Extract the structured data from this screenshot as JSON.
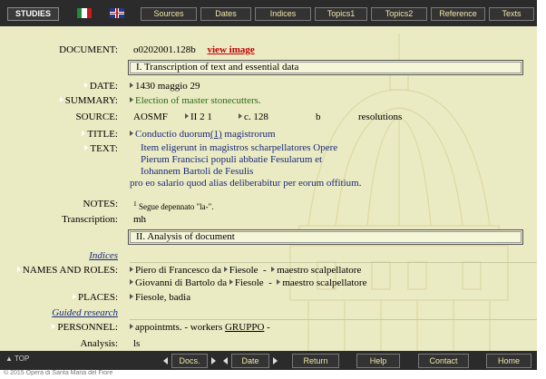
{
  "topbar": {
    "brand": "STUDIES",
    "nav": [
      "Sources",
      "Dates",
      "Indices",
      "Topics1",
      "Topics2",
      "Reference",
      "Texts"
    ]
  },
  "record": {
    "document_label": "DOCUMENT:",
    "document_id": "o0202001.128b",
    "view_image": "view image",
    "section1": "I. Transcription of text and essential data",
    "date_label": "DATE:",
    "date": "1430 maggio 29",
    "summary_label": "SUMMARY:",
    "summary": "Election of master stonecutters.",
    "source_label": "SOURCE:",
    "source_archive": "AOSMF",
    "source_series": "II 2 1",
    "source_page": "c. 128",
    "source_side": "b",
    "source_type": "resolutions",
    "title_label": "TITLE:",
    "title_pre": "Conductio duorum",
    "title_note": "(1)",
    "title_post": " magistrorum",
    "text_label": "TEXT:",
    "text_lines": [
      "Item eligerunt in magistros scharpellatores Opere",
      "Pierum Francisci populi abbatie Fesularum et",
      "Iohannem Bartoli de Fesulis",
      "pro eo salario quod alias deliberabitur per eorum offitium."
    ],
    "notes_label": "NOTES:",
    "note_num": "1",
    "note_text": "Segue depennato \"la-\".",
    "transcription_label": "Transcription:",
    "transcription": "mh",
    "section2": "II. Analysis of document",
    "indices_label": "Indices",
    "names_label": "NAMES AND ROLES:",
    "names": [
      {
        "name": "Piero di Francesco da",
        "place": "Fiesole",
        "dash": "-",
        "role": "maestro scalpellatore"
      },
      {
        "name": "Giovanni di Bartolo da",
        "place": "Fiesole",
        "dash": "-",
        "role": "maestro scalpellatore"
      }
    ],
    "places_label": "PLACES:",
    "places": "Fiesole, badia",
    "guided_label": "Guided research",
    "personnel_label": "PERSONNEL:",
    "personnel_pre": "appointmts. - workers",
    "personnel_link": "GRUPPO",
    "personnel_post": " -",
    "analysis_label": "Analysis:",
    "analysis": "ls"
  },
  "bottombar": {
    "top": "TOP",
    "docs": "Docs.",
    "date": "Date",
    "return": "Return",
    "help": "Help",
    "contact": "Contact",
    "home": "Home"
  },
  "footer": "© 2015 Opera di Santa Maria del Fiore"
}
